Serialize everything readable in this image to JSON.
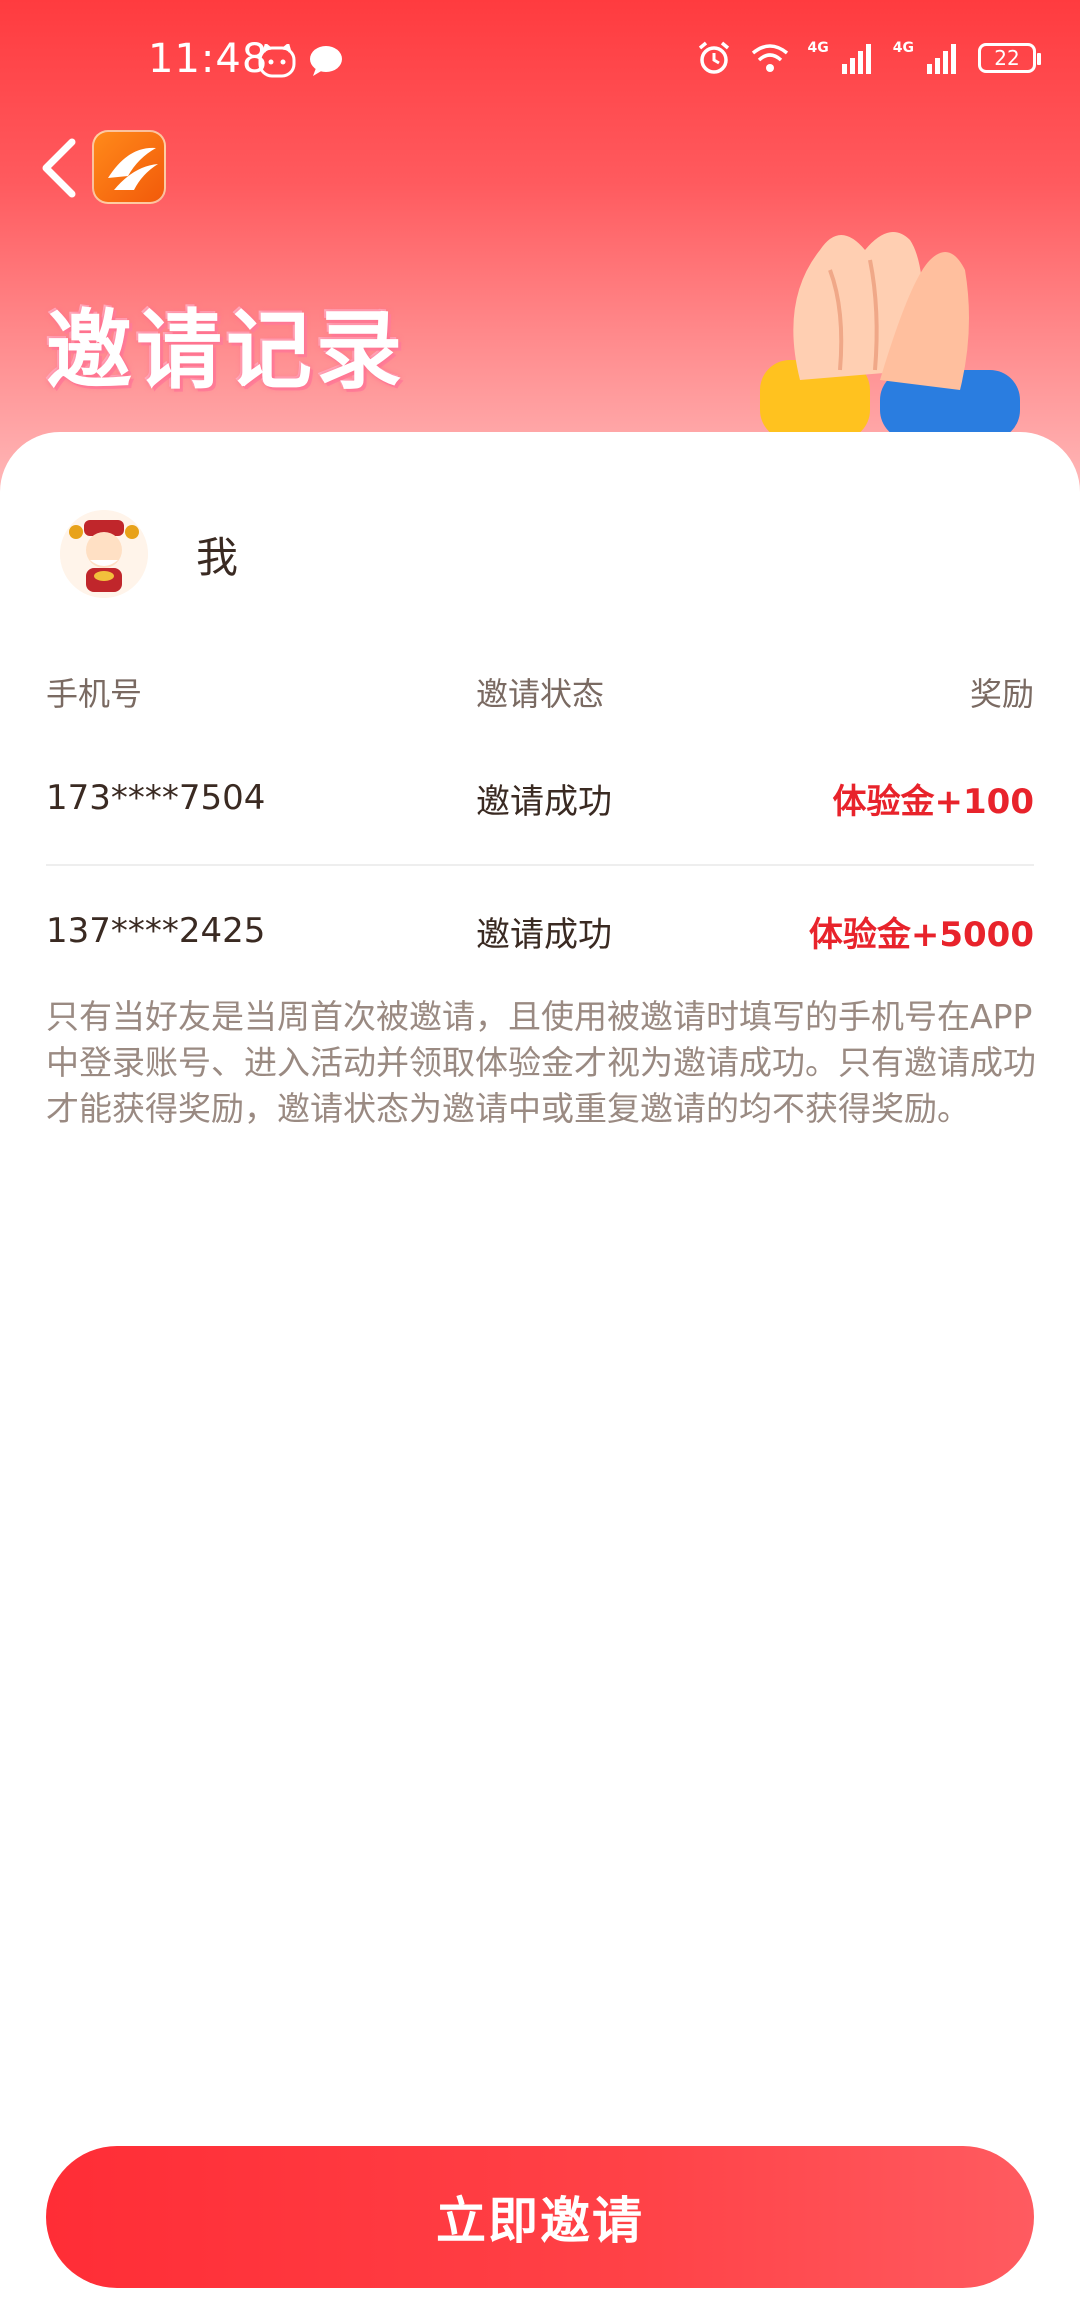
{
  "status_bar": {
    "time": "11:48",
    "network_label_1": "4G",
    "network_label_2": "4G",
    "battery": "22"
  },
  "header": {
    "title": "邀请记录"
  },
  "user": {
    "name": "我"
  },
  "table": {
    "columns": [
      "手机号",
      "邀请状态",
      "奖励"
    ],
    "rows": [
      {
        "phone": "173****7504",
        "status": "邀请成功",
        "reward": "体验金+100"
      },
      {
        "phone": "137****2425",
        "status": "邀请成功",
        "reward": "体验金+5000"
      }
    ]
  },
  "note": "只有当好友是当周首次被邀请，且使用被邀请时填写的手机号在APP中登录账号、进入活动并领取体验金才视为邀请成功。只有邀请成功才能获得奖励，邀请状态为邀请中或重复邀请的均不获得奖励。",
  "invite_button": "立即邀请",
  "colors": {
    "brand_red": "#ff3b3f",
    "reward_red": "#e8232b",
    "note_gray": "#9a8a82"
  }
}
